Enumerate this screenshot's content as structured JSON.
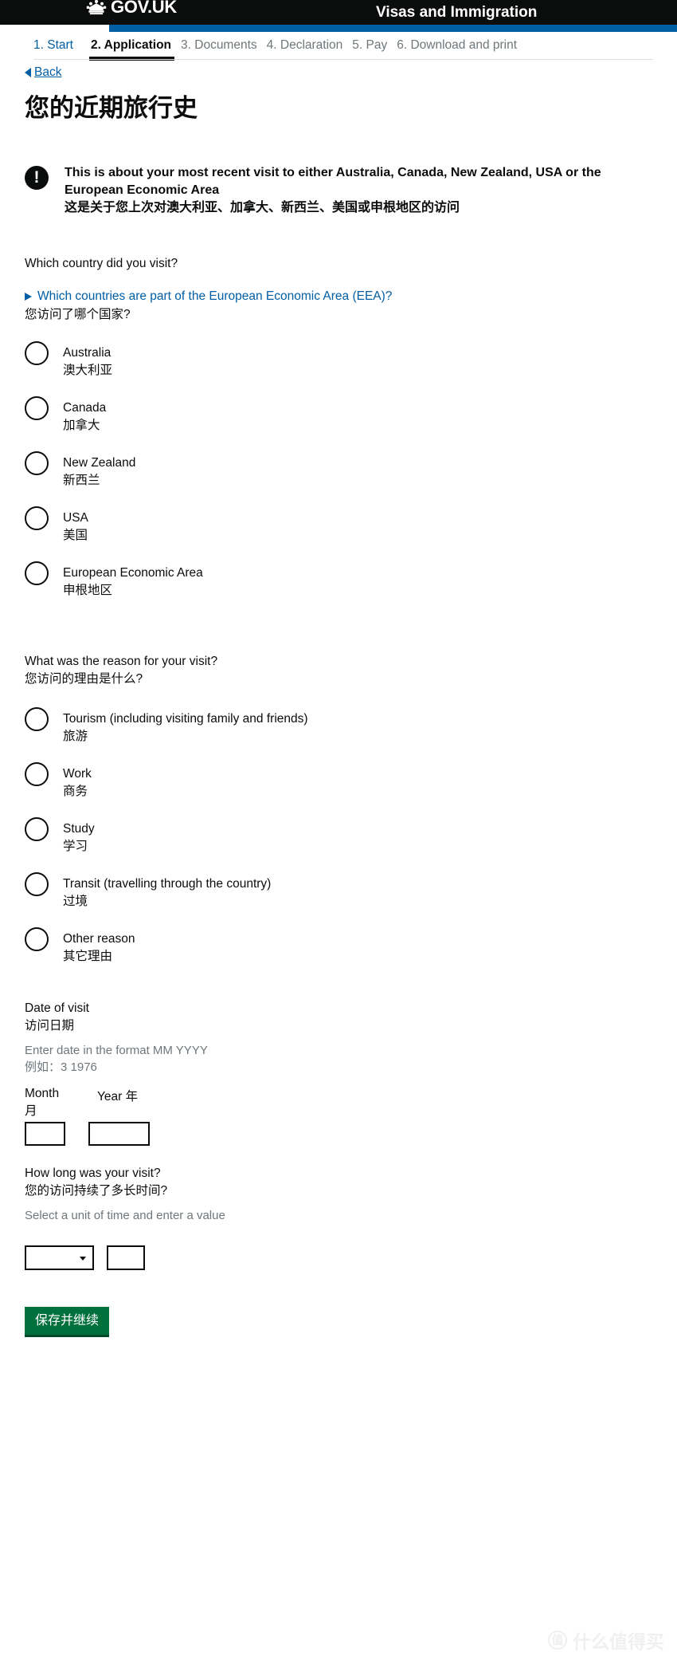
{
  "header": {
    "brand": "GOV.UK",
    "crown_icon": "crown-icon",
    "service_name": "Visas and Immigration"
  },
  "progress_nav": {
    "steps": [
      {
        "label": "1. Start",
        "state": "link"
      },
      {
        "label": "2. Application",
        "state": "active"
      },
      {
        "label": "3. Documents",
        "state": "inactive"
      },
      {
        "label": "4. Declaration",
        "state": "inactive"
      },
      {
        "label": "5. Pay",
        "state": "inactive"
      },
      {
        "label": "6. Download and print",
        "state": "inactive"
      }
    ]
  },
  "back_link": {
    "label": "Back",
    "icon": "left-triangle-icon"
  },
  "page": {
    "title": "您的近期旅行史"
  },
  "notice": {
    "icon": "exclamation-icon",
    "en_line1": "This is about your most recent visit to either Australia, Canada, New Zealand, USA or",
    "en_line2": "the European Economic Area",
    "zh": "这是关于您上次对澳大利亚、加拿大、新西兰、美国或申根地区的访问"
  },
  "country_question": {
    "label_en": "Which country did you visit?",
    "details_link": "Which countries are part of the European Economic Area (EEA)?",
    "details_icon": "right-triangle-icon",
    "label_zh": "您访问了哪个国家?",
    "options": [
      {
        "en": "Australia",
        "zh": "澳大利亚"
      },
      {
        "en": "Canada",
        "zh": "加拿大"
      },
      {
        "en": "New Zealand",
        "zh": "新西兰"
      },
      {
        "en": "USA",
        "zh": "美国"
      },
      {
        "en": "European Economic Area",
        "zh": "申根地区"
      }
    ]
  },
  "reason_question": {
    "label_en": "What was the reason for your visit?",
    "label_zh": "您访问的理由是什么?",
    "options": [
      {
        "en": "Tourism (including visiting family and friends)",
        "zh": "旅游"
      },
      {
        "en": "Work",
        "zh": "商务"
      },
      {
        "en": "Study",
        "zh": "学习"
      },
      {
        "en": "Transit (travelling through the country)",
        "zh": "过境"
      },
      {
        "en": "Other reason",
        "zh": "其它理由"
      }
    ]
  },
  "date_of_visit": {
    "label_en": "Date of visit",
    "label_zh": "访问日期",
    "hint_en": "Enter date in the format MM YYYY",
    "hint_zh": "例如：3 1976",
    "month_label": "Month 月",
    "year_label": "Year 年",
    "month_value": "",
    "year_value": ""
  },
  "duration": {
    "label_en": "How long was your visit?",
    "label_zh": "您的访问持续了多长时间?",
    "hint_en": "Select a unit of time and enter a value",
    "unit_selected": "",
    "unit_caret_icon": "chevron-down-icon",
    "value": ""
  },
  "submit": {
    "label": "保存并继续"
  },
  "watermark": {
    "badge": "值",
    "text": "什么值得买"
  }
}
